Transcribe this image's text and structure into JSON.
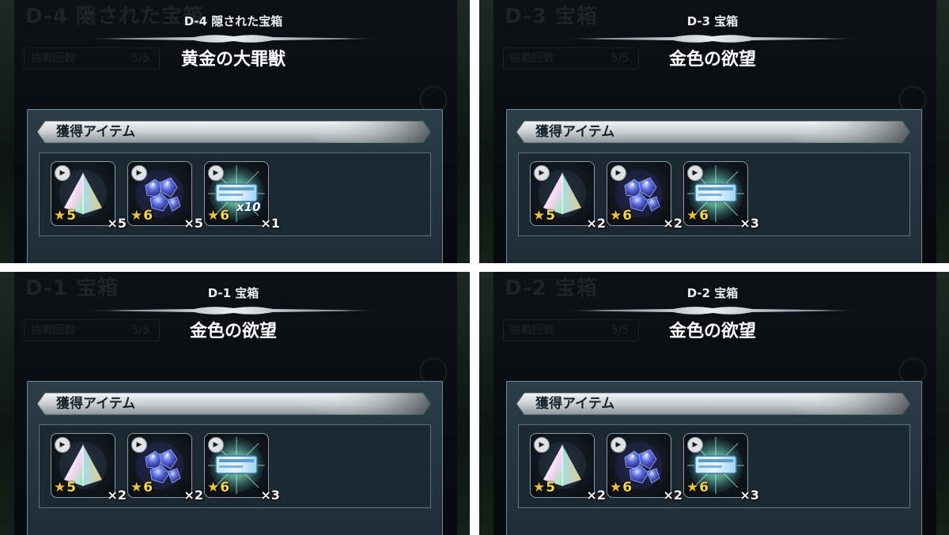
{
  "panels": [
    {
      "bg_title": "D-4 隠された宝箱",
      "bg_count_label": "挑戦回数",
      "bg_count_value": "5/5",
      "subtitle": "D-4 隠された宝箱",
      "title": "黄金の大罪獣",
      "section": "獲得アイテム",
      "items": [
        {
          "kind": "prism",
          "icon": "rainbow-prism-icon",
          "stars": "5",
          "qty": "×5"
        },
        {
          "kind": "gems",
          "icon": "blue-gem-cluster-icon",
          "stars": "6",
          "qty": "×5"
        },
        {
          "kind": "ticket",
          "icon": "summon-ticket-icon",
          "stars": "6",
          "qty": "×1",
          "multiplier": "x10"
        }
      ]
    },
    {
      "bg_title": "D-3 宝箱",
      "bg_count_label": "挑戦回数",
      "bg_count_value": "5/5",
      "subtitle": "D-3 宝箱",
      "title": "金色の欲望",
      "section": "獲得アイテム",
      "items": [
        {
          "kind": "prism",
          "icon": "rainbow-prism-icon",
          "stars": "5",
          "qty": "×2"
        },
        {
          "kind": "gems",
          "icon": "blue-gem-cluster-icon",
          "stars": "6",
          "qty": "×2"
        },
        {
          "kind": "ticket",
          "icon": "summon-ticket-icon",
          "stars": "6",
          "qty": "×3"
        }
      ]
    },
    {
      "bg_title": "D-1 宝箱",
      "bg_count_label": "挑戦回数",
      "bg_count_value": "5/5",
      "subtitle": "D-1 宝箱",
      "title": "金色の欲望",
      "section": "獲得アイテム",
      "items": [
        {
          "kind": "prism",
          "icon": "rainbow-prism-icon",
          "stars": "5",
          "qty": "×2"
        },
        {
          "kind": "gems",
          "icon": "blue-gem-cluster-icon",
          "stars": "6",
          "qty": "×2"
        },
        {
          "kind": "ticket",
          "icon": "summon-ticket-icon",
          "stars": "6",
          "qty": "×3"
        }
      ]
    },
    {
      "bg_title": "D-2 宝箱",
      "bg_count_label": "挑戦回数",
      "bg_count_value": "5/5",
      "subtitle": "D-2 宝箱",
      "title": "金色の欲望",
      "section": "獲得アイテム",
      "items": [
        {
          "kind": "prism",
          "icon": "rainbow-prism-icon",
          "stars": "5",
          "qty": "×2"
        },
        {
          "kind": "gems",
          "icon": "blue-gem-cluster-icon",
          "stars": "6",
          "qty": "×2"
        },
        {
          "kind": "ticket",
          "icon": "summon-ticket-icon",
          "stars": "6",
          "qty": "×3"
        }
      ]
    }
  ]
}
